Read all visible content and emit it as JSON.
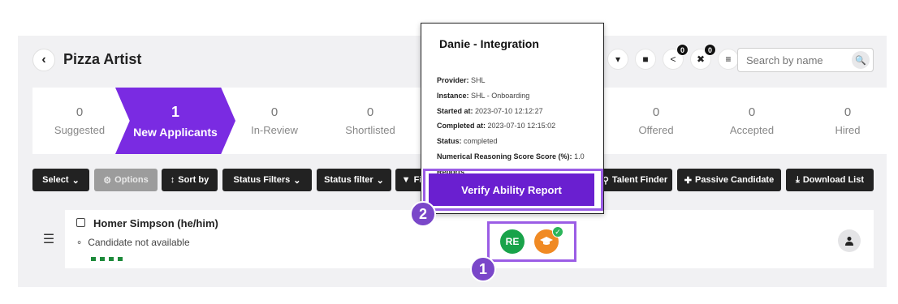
{
  "header": {
    "back_icon": "chevron-left-icon",
    "title": "Pizza Artist",
    "icons": [
      {
        "name": "dropdown-caret-icon",
        "badge": ""
      },
      {
        "name": "note-icon",
        "badge": ""
      },
      {
        "name": "share-icon",
        "badge": "0"
      },
      {
        "name": "remove-user-icon",
        "badge": "0"
      },
      {
        "name": "list-icon",
        "badge": ""
      }
    ],
    "search": {
      "placeholder": "Search by name",
      "value": ""
    }
  },
  "pipeline": [
    {
      "count": "0",
      "label": "Suggested"
    },
    {
      "count": "1",
      "label": "New Applicants",
      "active": true
    },
    {
      "count": "0",
      "label": "In-Review"
    },
    {
      "count": "0",
      "label": "Shortlisted"
    },
    {
      "count": "0",
      "label": "Offered"
    },
    {
      "count": "0",
      "label": "Accepted"
    },
    {
      "count": "0",
      "label": "Hired"
    }
  ],
  "toolbar": {
    "select": "Select",
    "options": "Options",
    "sort_by": "Sort by",
    "status_filters": "Status Filters",
    "status_filter": "Status filter",
    "filter_partial": "Fi",
    "talent_finder": "Talent Finder",
    "passive_candidate": "Passive Candidate",
    "download_list": "Download List"
  },
  "candidate": {
    "name": "Homer Simpson (he/him)",
    "availability": "Candidate not available",
    "assessment_badge": "RE"
  },
  "popup": {
    "title": "Danie - Integration",
    "lines": [
      {
        "label": "Provider:",
        "value": "SHL"
      },
      {
        "label": "Instance:",
        "value": "SHL - Onboarding"
      },
      {
        "label": "Started at:",
        "value": "2023-07-10 12:12:27"
      },
      {
        "label": "Completed at:",
        "value": "2023-07-10 12:15:02"
      },
      {
        "label": "Status:",
        "value": "completed"
      },
      {
        "label": "Numerical Reasoning Score Score (%):",
        "value": "1.0"
      },
      {
        "label": "Reports",
        "value": ""
      }
    ],
    "verify_button": "Verify Ability Report"
  },
  "annotations": {
    "step1": "1",
    "step2": "2"
  },
  "colors": {
    "accent": "#7a2be2",
    "highlight": "#9b5de5",
    "success": "#19a34a",
    "warning": "#f08a24"
  }
}
